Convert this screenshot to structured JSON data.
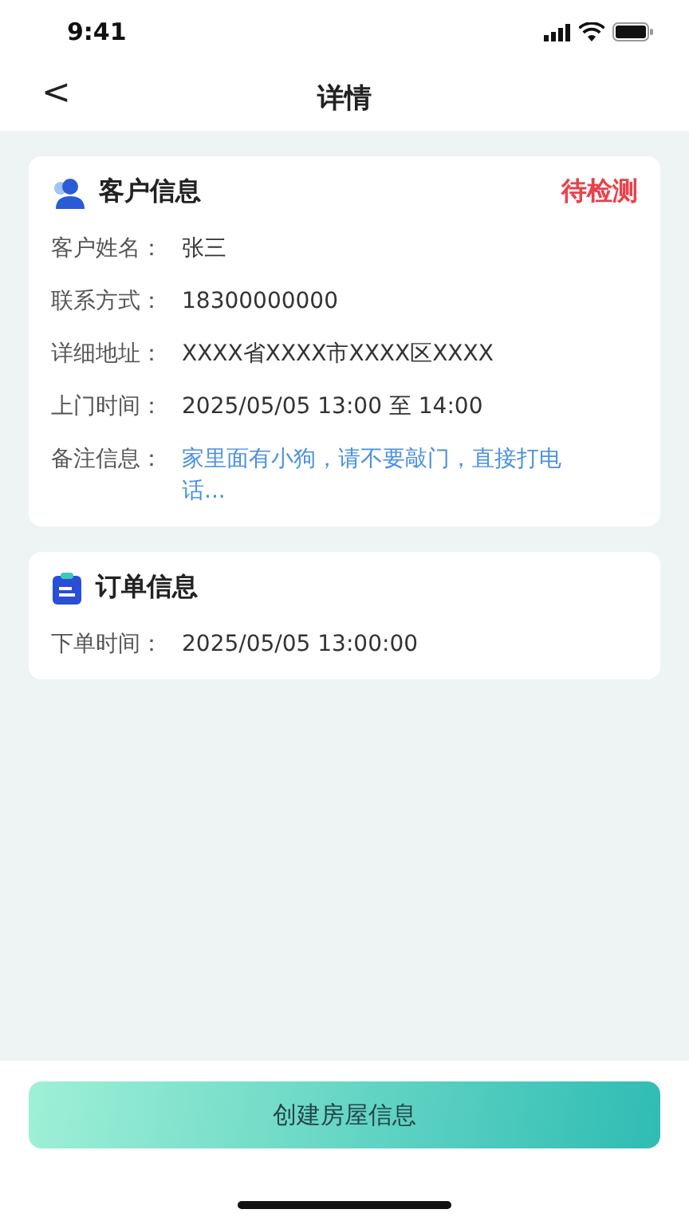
{
  "status_bar": {
    "time": "9:41"
  },
  "nav": {
    "back": "<",
    "title": "详情"
  },
  "customer_card": {
    "title": "客户信息",
    "status": "待检测",
    "fields": [
      {
        "label": "客户姓名：",
        "value": "张三",
        "kind": "plain"
      },
      {
        "label": "联系方式：",
        "value": "18300000000",
        "kind": "plain"
      },
      {
        "label": "详细地址：",
        "value": "XXXX省XXXX市XXXX区XXXX",
        "kind": "plain"
      },
      {
        "label": "上门时间：",
        "value": "2025/05/05  13:00 至 14:00",
        "kind": "plain"
      },
      {
        "label": "备注信息：",
        "value": "家里面有小狗，请不要敲门，直接打电话...",
        "kind": "note"
      }
    ]
  },
  "order_card": {
    "title": "订单信息",
    "fields": [
      {
        "label": "下单时间：",
        "value": "2025/05/05  13:00:00",
        "kind": "plain"
      }
    ]
  },
  "primary_button": "创建房屋信息"
}
